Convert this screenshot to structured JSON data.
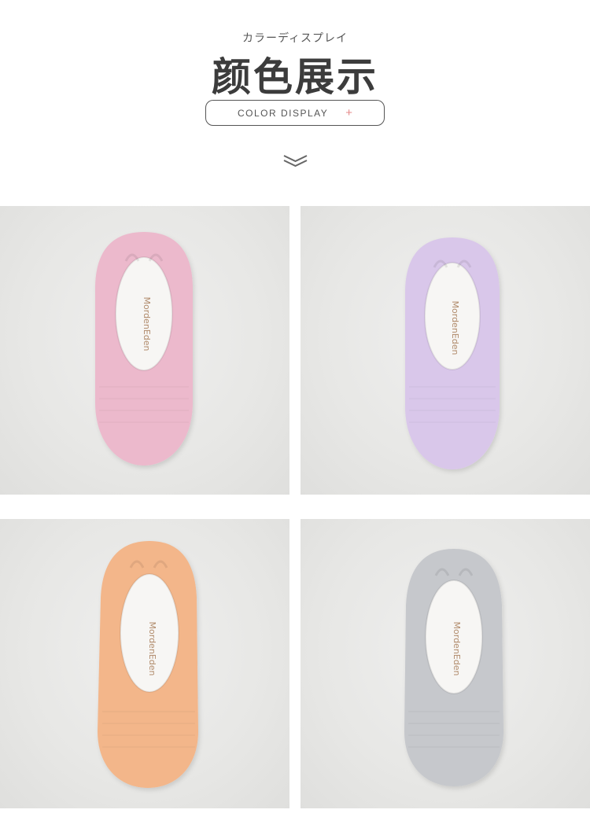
{
  "header": {
    "subtitle_jp": "カラーディスプレイ",
    "title": "颜色展示",
    "pill_label": "COLOR DISPLAY",
    "pill_plus": "+"
  },
  "icons": {
    "chevron": "double-chevron-down-icon",
    "plus": "plus-icon"
  },
  "products": [
    {
      "name": "pink-sock",
      "color": "#ecb9cc",
      "label_text": "MordenEden"
    },
    {
      "name": "lavender-sock",
      "color": "#d9c7ea",
      "label_text": "MordenEden"
    },
    {
      "name": "orange-sock",
      "color": "#f3b68a",
      "label_text": "MordenEden"
    },
    {
      "name": "gray-sock",
      "color": "#c6c8cc",
      "label_text": "MordenEden"
    }
  ]
}
